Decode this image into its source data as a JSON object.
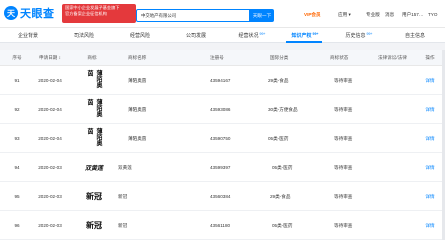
{
  "header": {
    "logo_mark": "天",
    "logo_text": "天眼查",
    "promo_lines": [
      "国家中小企业发展子基金旗下",
      "官方备案企业征信机构"
    ],
    "search_value": "中交地产有限公司",
    "search_button": "天眼一下",
    "vip_label": "VIP会员",
    "nav": [
      "应用 ▾",
      "专业版",
      "消息",
      "用户157…",
      "TYO"
    ]
  },
  "tabs": [
    {
      "label": "企业背景",
      "badge": ""
    },
    {
      "label": "司法风险",
      "badge": ""
    },
    {
      "label": "经营风险",
      "badge": ""
    },
    {
      "label": "公司发展",
      "badge": ""
    },
    {
      "label": "经营状况",
      "badge": "99+"
    },
    {
      "label": "知识产权",
      "badge": "99+"
    },
    {
      "label": "历史信息",
      "badge": "99+"
    },
    {
      "label": "自主信息",
      "badge": ""
    }
  ],
  "table": {
    "columns": [
      "序号",
      "申请日期 ↕",
      "商标",
      "商标名称",
      "注册号",
      "国际分类",
      "商标状态",
      "法律诉讼/法律",
      "操作"
    ],
    "rows": [
      {
        "index": "91",
        "date": "2020-02-04",
        "mark": "薄陌奥茵",
        "name": "薄陌奥茵",
        "reg": "43594167",
        "class": "29类-食品",
        "status": "等待审查",
        "action": "详情"
      },
      {
        "index": "92",
        "date": "2020-02-04",
        "mark": "薄陌奥茵",
        "name": "薄陌奥茵",
        "reg": "43593086",
        "class": "30类-方便食品",
        "status": "等待审查",
        "action": "详情"
      },
      {
        "index": "93",
        "date": "2020-02-04",
        "mark": "薄陌奥茵",
        "name": "薄陌奥茵",
        "reg": "43590750",
        "class": "05类-医药",
        "status": "等待审查",
        "action": "详情"
      },
      {
        "index": "94",
        "date": "2020-02-03",
        "mark": "双黄莲",
        "name": "双黄莲",
        "reg": "43599397",
        "class": "05类-医药",
        "status": "等待审查",
        "action": "详情"
      },
      {
        "index": "95",
        "date": "2020-02-03",
        "mark": "新冠",
        "name": "新冠",
        "reg": "43560384",
        "class": "29类-食品",
        "status": "等待审查",
        "action": "详情"
      },
      {
        "index": "96",
        "date": "2020-02-03",
        "mark": "新冠",
        "name": "新冠",
        "reg": "43561180",
        "class": "05类-医药",
        "status": "等待审查",
        "action": "详情"
      }
    ]
  },
  "colors": {
    "accent": "#0084ff",
    "vip": "#ff6600",
    "promo": "#e4393c"
  }
}
